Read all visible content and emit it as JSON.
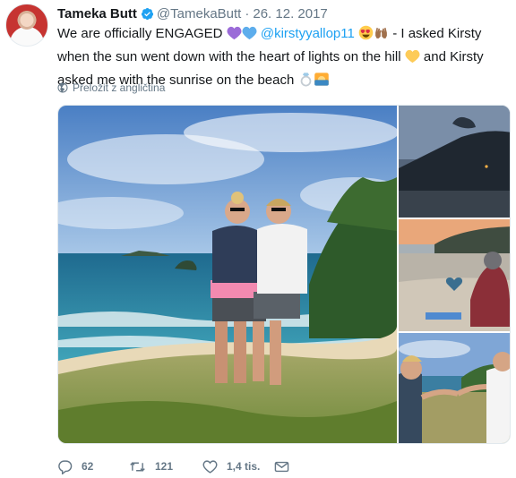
{
  "author": {
    "display_name": "Tameka Butt",
    "handle": "@TamekaButt",
    "separator": "·",
    "date": "26. 12. 2017",
    "verified_icon": "verified-badge-icon"
  },
  "tweet": {
    "text_part1": "We are officially ENGAGED",
    "mention": "@kirstyyallop11",
    "text_part2": "- I asked Kirsty when the sun went down with the heart of lights on the hill",
    "text_part3": "and Kirsty asked me with the sunrise on the beach"
  },
  "translate": {
    "label": "Přeložit z angličtina",
    "icon": "globe-icon"
  },
  "media": {
    "main_photo": "beach-couple-photo",
    "side_photos": [
      "night-hill-photo",
      "beach-heart-photo",
      "ring-exchange-photo"
    ]
  },
  "actions": {
    "reply_count": "62",
    "retweet_count": "121",
    "like_count": "1,4 tis."
  },
  "colors": {
    "accent": "#1da1f2",
    "text": "#14171a",
    "muted": "#657786"
  }
}
